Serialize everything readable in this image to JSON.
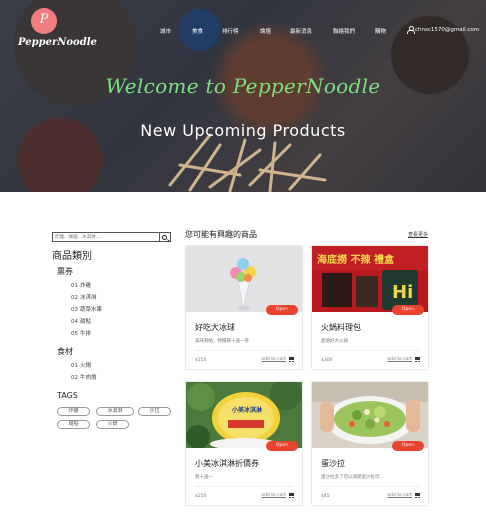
{
  "brand": {
    "logo_letter": "P",
    "name": "PepperNoodle"
  },
  "nav": {
    "items": [
      {
        "label": "城市"
      },
      {
        "label": "美食"
      },
      {
        "label": "排行榜"
      },
      {
        "label": "論壇"
      },
      {
        "label": "最新消息"
      },
      {
        "label": "聯絡我們"
      },
      {
        "label": "購物"
      }
    ],
    "user_email": "chnsc1570@gmail.com"
  },
  "hero": {
    "welcome": "Welcome to PepperNoodle",
    "title": "New Upcoming Products"
  },
  "sidebar": {
    "search_placeholder": "炸雞、咖哩、冰淇淋...",
    "categories_title": "商品類別",
    "groups": [
      {
        "title": "票券",
        "items": [
          {
            "num": "01",
            "label": "炸雞"
          },
          {
            "num": "02",
            "label": "冰淇淋"
          },
          {
            "num": "03",
            "label": "蔬菜水果"
          },
          {
            "num": "04",
            "label": "甜點"
          },
          {
            "num": "05",
            "label": "牛排"
          }
        ]
      },
      {
        "title": "食材",
        "items": [
          {
            "num": "01",
            "label": "火鍋"
          },
          {
            "num": "02",
            "label": "牛肉燴"
          }
        ]
      }
    ],
    "tags_title": "TAGS",
    "tags": [
      "炸雞",
      "冰淇淋",
      "沙拉",
      "甜點",
      "火鍋"
    ]
  },
  "main": {
    "section_title": "您可能有興趣的商品",
    "see_more": "查看更多",
    "open_label": "Open",
    "add_to_cart": "add to cart",
    "products": [
      {
        "title": "好吃大冰球",
        "desc": "美味夠給，特價買十送一券",
        "price": "$150"
      },
      {
        "title": "火鍋料理包",
        "desc": "超值好大火鍋",
        "price": "$300"
      },
      {
        "title": "小美冰淇淋折價券",
        "desc": "買十送一",
        "price": "$250"
      },
      {
        "title": "蛋沙拉",
        "desc": "蛋沙拉多了可以減肥蛋沙拉可...",
        "price": "$45"
      }
    ],
    "card2_banner": "海底撈 不辣 禮盒",
    "card3_package": "小美冰淇淋"
  },
  "colors": {
    "accent": "#e8442e",
    "welcome": "#7de07e",
    "logo": "#f07d7d"
  }
}
